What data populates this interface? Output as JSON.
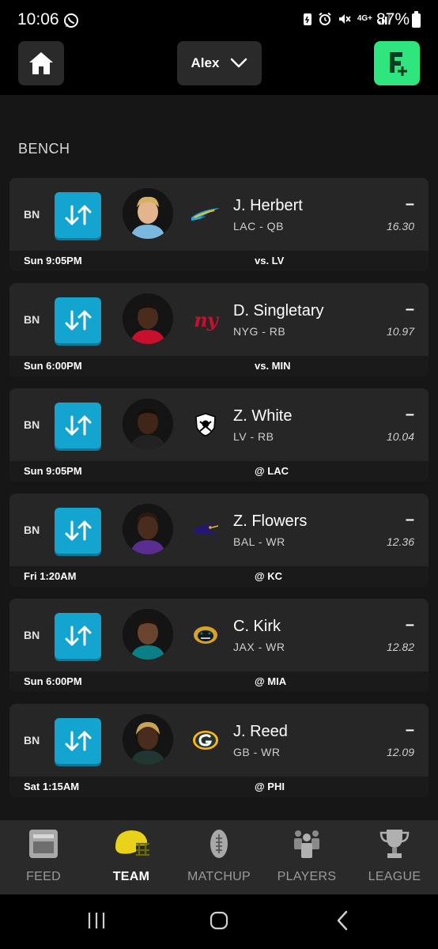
{
  "status_bar": {
    "time": "10:06",
    "battery": "87%",
    "network": "4G+"
  },
  "header": {
    "team_name": "Alex",
    "icons": {
      "home": "home-icon",
      "dropdown": "chevron-down-icon",
      "add": "add-team-icon"
    }
  },
  "section": {
    "title": "BENCH"
  },
  "players": [
    {
      "slot": "BN",
      "name": "J. Herbert",
      "info": "LAC - QB",
      "score": "–",
      "projection": "16.30",
      "game_time": "Sun 9:05PM",
      "opponent": "vs. LV",
      "team_logo": "chargers-logo-icon"
    },
    {
      "slot": "BN",
      "name": "D. Singletary",
      "info": "NYG - RB",
      "score": "–",
      "projection": "10.97",
      "game_time": "Sun 6:00PM",
      "opponent": "vs. MIN",
      "team_logo": "giants-logo-icon"
    },
    {
      "slot": "BN",
      "name": "Z. White",
      "info": "LV - RB",
      "score": "–",
      "projection": "10.04",
      "game_time": "Sun 9:05PM",
      "opponent": "@ LAC",
      "team_logo": "raiders-logo-icon"
    },
    {
      "slot": "BN",
      "name": "Z. Flowers",
      "info": "BAL - WR",
      "score": "–",
      "projection": "12.36",
      "game_time": "Fri 1:20AM",
      "opponent": "@ KC",
      "team_logo": "ravens-logo-icon"
    },
    {
      "slot": "BN",
      "name": "C. Kirk",
      "info": "JAX - WR",
      "score": "–",
      "projection": "12.82",
      "game_time": "Sun 6:00PM",
      "opponent": "@ MIA",
      "team_logo": "jaguars-logo-icon"
    },
    {
      "slot": "BN",
      "name": "J. Reed",
      "info": "GB - WR",
      "score": "–",
      "projection": "12.09",
      "game_time": "Sat 1:15AM",
      "opponent": "@ PHI",
      "team_logo": "packers-logo-icon"
    }
  ],
  "nav": {
    "items": [
      {
        "label": "FEED",
        "icon": "feed-icon"
      },
      {
        "label": "TEAM",
        "icon": "helmet-icon"
      },
      {
        "label": "MATCHUP",
        "icon": "football-icon"
      },
      {
        "label": "PLAYERS",
        "icon": "players-icon"
      },
      {
        "label": "LEAGUE",
        "icon": "trophy-icon"
      }
    ],
    "active": "TEAM"
  },
  "colors": {
    "accent_green": "#2fe57e",
    "swap_blue": "#13a5cf",
    "team_helmet": "#e8d21a",
    "card_bg": "#262626"
  }
}
